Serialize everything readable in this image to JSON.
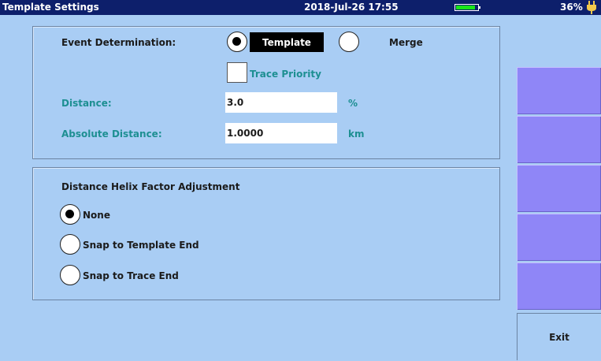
{
  "status_bar": {
    "title": "Template Settings",
    "datetime": "2018-Jul-26 17:55",
    "battery_percent": "36%",
    "battery_level": 0.9,
    "battery_color": "#19e619"
  },
  "event_determination": {
    "label": "Event Determination:",
    "options": [
      "Template",
      "Merge"
    ],
    "selected": "Template",
    "trace_priority_label": "Trace Priority",
    "trace_priority_checked": false
  },
  "distance": {
    "label": "Distance:",
    "value": "3.0",
    "unit": "%"
  },
  "absolute_distance": {
    "label": "Absolute Distance:",
    "value": "1.0000",
    "unit": "km"
  },
  "helix": {
    "heading": "Distance Helix Factor Adjustment",
    "options": [
      "None",
      "Snap to Template End",
      "Snap to Trace End"
    ],
    "selected": "None"
  },
  "side_menu": {
    "buttons": [
      "",
      "",
      "",
      "",
      "",
      "Exit"
    ]
  },
  "icons": {
    "power": "power-plug-icon"
  },
  "colors": {
    "background": "#a9cdf4",
    "title_bar": "#0d1f6b",
    "side_button": "#8f86f7",
    "teal_text": "#1d8f92"
  }
}
